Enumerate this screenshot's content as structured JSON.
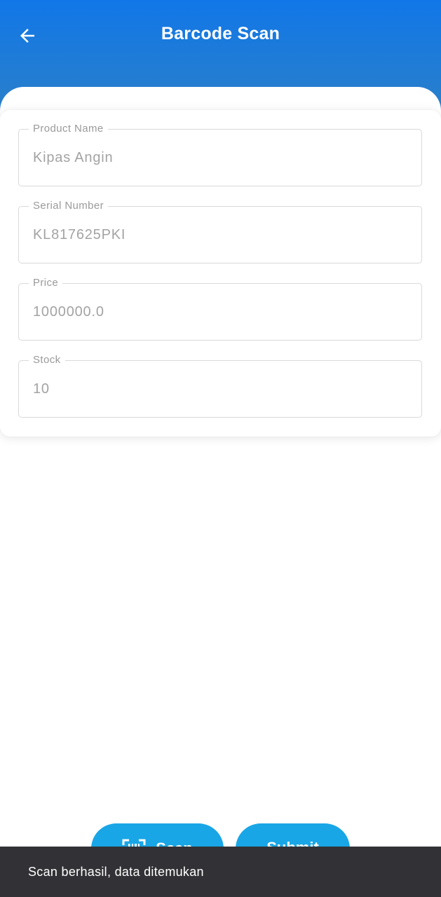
{
  "header": {
    "title": "Barcode Scan",
    "back_icon": "arrow-left-icon",
    "gradient_top": "#1177e8",
    "gradient_bottom": "#2a7fc9"
  },
  "form": {
    "fields": [
      {
        "label": "Product Name",
        "value": "Kipas Angin"
      },
      {
        "label": "Serial Number",
        "value": "KL817625PKI"
      },
      {
        "label": "Price",
        "value": "1000000.0"
      },
      {
        "label": "Stock",
        "value": "10"
      }
    ]
  },
  "actions": {
    "scan_label": "Scan",
    "scan_icon": "barcode-scan-icon",
    "submit_label": "Submit",
    "button_color": "#19a6e6"
  },
  "snackbar": {
    "message": "Scan berhasil, data ditemukan",
    "background": "#323236"
  }
}
